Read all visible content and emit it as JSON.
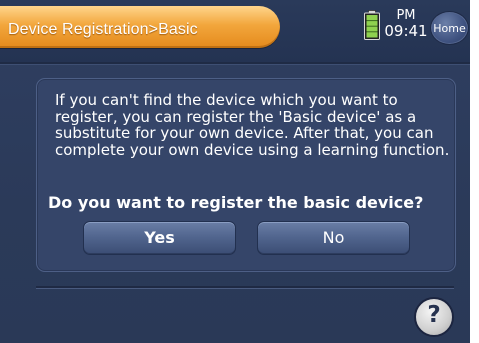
{
  "header": {
    "title": "Device Registration>Basic",
    "ampm": "PM",
    "time": "09:41",
    "home_label": "Home",
    "battery_level": 1.0
  },
  "dialog": {
    "message": "If you can't find the device which you want to register, you can register the 'Basic device' as a substitute for your own device. After that, you can complete your own device using a learning function.",
    "question": "Do you want to register the basic device?",
    "yes_label": "Yes",
    "no_label": "No"
  },
  "footer": {
    "help_label": "?"
  },
  "colors": {
    "title_accent": "#f2a63c",
    "background": "#2f3f61",
    "battery": "#8fd14f"
  },
  "icons": [
    "battery-icon",
    "help-icon"
  ]
}
